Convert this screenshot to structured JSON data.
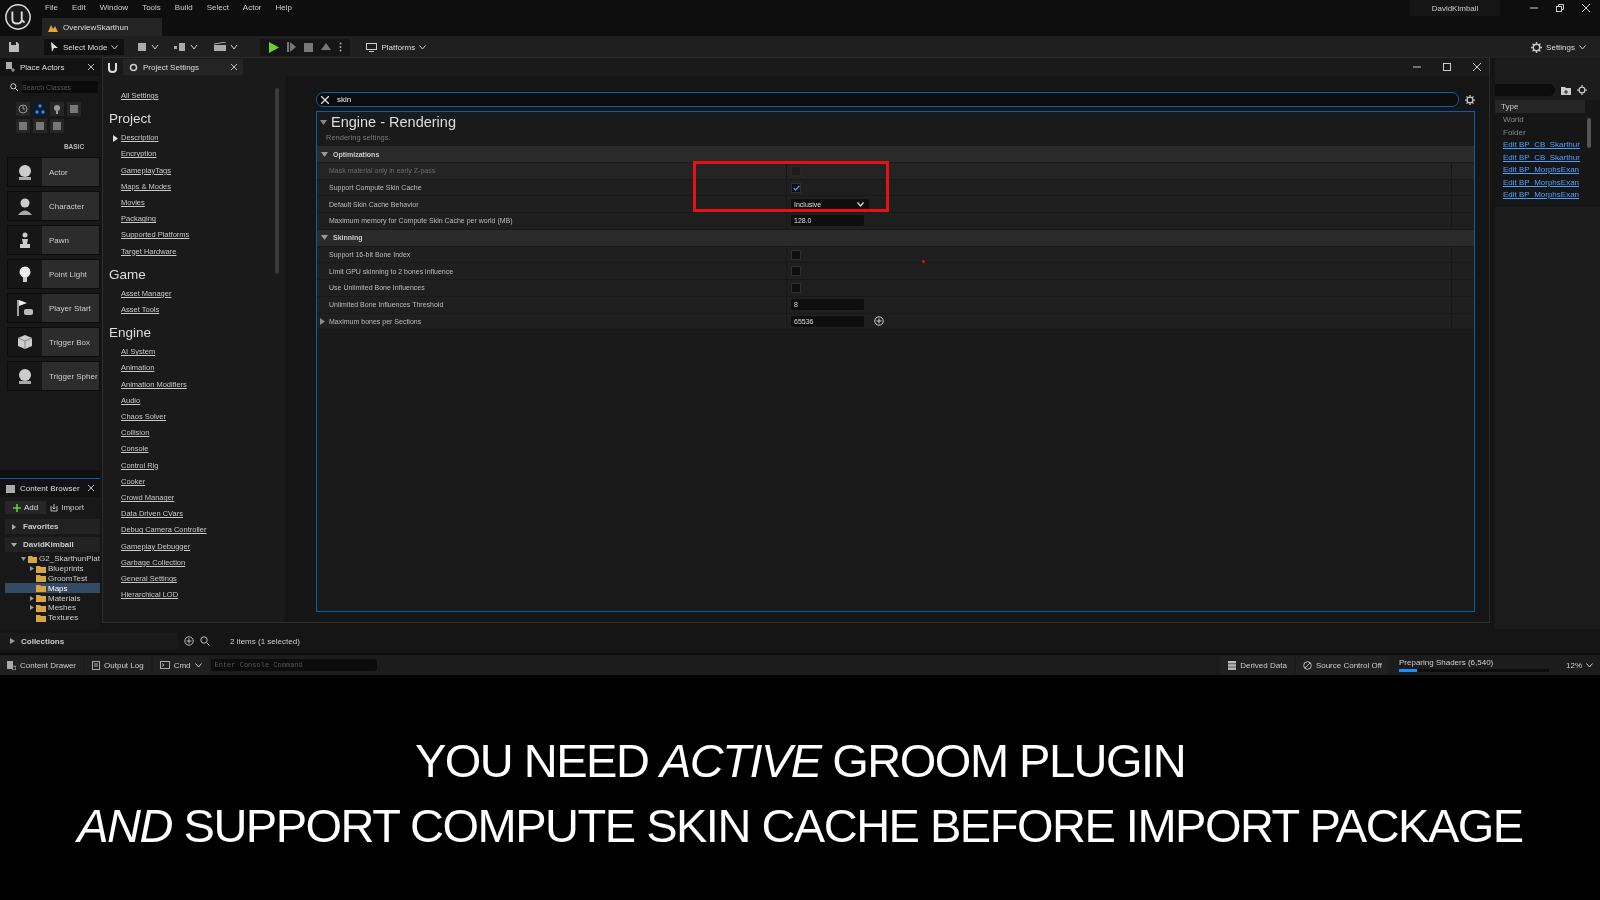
{
  "menu": [
    "File",
    "Edit",
    "Window",
    "Tools",
    "Build",
    "Select",
    "Actor",
    "Help"
  ],
  "level_tab": "OverviewSkarthun",
  "user": "DavidKimball",
  "toolbar": {
    "mode": "Select Mode",
    "platforms": "Platforms",
    "settings": "Settings"
  },
  "place_actors": {
    "title": "Place Actors",
    "search_placeholder": "Search Classes",
    "category_icons": [
      {
        "selected": false
      },
      {
        "selected": true
      },
      {
        "selected": false
      },
      {
        "selected": false
      },
      {
        "selected": false
      },
      {
        "selected": false
      },
      {
        "selected": false
      }
    ],
    "category": "BASIC",
    "items": [
      "Actor",
      "Character",
      "Pawn",
      "Point Light",
      "Player Start",
      "Trigger Box",
      "Trigger Spher"
    ]
  },
  "content_browser": {
    "title": "Content Browser",
    "add": "Add",
    "import": "Import",
    "sections": [
      {
        "label": "Favorites",
        "expanded": false
      },
      {
        "label": "DavidKimball",
        "expanded": true
      }
    ],
    "tree": [
      {
        "label": "G2_SkarthunPlat",
        "kind": "branch",
        "expanded": true,
        "selected": false,
        "children": [
          {
            "label": "Blueprints",
            "kind": "branch",
            "expanded": false,
            "selected": false
          },
          {
            "label": "GroomTest",
            "kind": "leaf",
            "selected": false
          },
          {
            "label": "Maps",
            "kind": "leaf",
            "selected": true
          },
          {
            "label": "Materials",
            "kind": "branch",
            "expanded": false,
            "selected": false
          },
          {
            "label": "Meshes",
            "kind": "branch",
            "expanded": false,
            "selected": false
          },
          {
            "label": "Textures",
            "kind": "leaf",
            "selected": false
          }
        ]
      }
    ],
    "collections": "Collections",
    "status": "2 items (1 selected)"
  },
  "outliner": {
    "column": "Type",
    "rows": [
      {
        "text": "World",
        "link": false
      },
      {
        "text": "Folder",
        "link": false
      },
      {
        "text": "Edit BP_CB_Skarthur",
        "link": true
      },
      {
        "text": "Edit BP_CB_Skarthur",
        "link": true
      },
      {
        "text": "Edit BP_MorphsExan",
        "link": true
      },
      {
        "text": "Edit BP_MorphsExan",
        "link": true
      },
      {
        "text": "Edit BP_MorphsExan",
        "link": true
      }
    ]
  },
  "project_settings": {
    "tab": "Project Settings",
    "all_settings": "All Settings",
    "nav_groups": [
      {
        "heading": "Project",
        "items": [
          {
            "label": "Description",
            "arrow": true
          },
          {
            "label": "Encryption",
            "arrow": false
          },
          {
            "label": "GameplayTags",
            "arrow": false
          },
          {
            "label": "Maps & Modes",
            "arrow": false
          },
          {
            "label": "Movies",
            "arrow": false
          },
          {
            "label": "Packaging",
            "arrow": false
          },
          {
            "label": "Supported Platforms",
            "arrow": false
          },
          {
            "label": "Target Hardware",
            "arrow": false
          }
        ]
      },
      {
        "heading": "Game",
        "items": [
          {
            "label": "Asset Manager",
            "arrow": false
          },
          {
            "label": "Asset Tools",
            "arrow": false
          }
        ]
      },
      {
        "heading": "Engine",
        "items": [
          {
            "label": "AI System",
            "arrow": false
          },
          {
            "label": "Animation",
            "arrow": false
          },
          {
            "label": "Animation Modifiers",
            "arrow": false
          },
          {
            "label": "Audio",
            "arrow": false
          },
          {
            "label": "Chaos Solver",
            "arrow": false
          },
          {
            "label": "Collision",
            "arrow": false
          },
          {
            "label": "Console",
            "arrow": false
          },
          {
            "label": "Control Rig",
            "arrow": false
          },
          {
            "label": "Cooker",
            "arrow": false
          },
          {
            "label": "Crowd Manager",
            "arrow": false
          },
          {
            "label": "Data Driven CVars",
            "arrow": false
          },
          {
            "label": "Debug Camera Controller",
            "arrow": false
          },
          {
            "label": "Gameplay Debugger",
            "arrow": false
          },
          {
            "label": "Garbage Collection",
            "arrow": false
          },
          {
            "label": "General Settings",
            "arrow": false
          },
          {
            "label": "Hierarchical LOD",
            "arrow": false
          }
        ]
      }
    ],
    "search": "skin",
    "section": {
      "title": "Engine - Rendering",
      "description": "Rendering settings.",
      "categories": [
        {
          "name": "Optimizations",
          "expanded": true,
          "rows": [
            {
              "label": "Mask material only in early Z-pass",
              "kind": "checkbox",
              "checked": false,
              "disabled": true
            },
            {
              "label": "Support Compute Skin Cache",
              "kind": "checkbox",
              "checked": true,
              "disabled": false
            },
            {
              "label": "Default Skin Cache Behavior",
              "kind": "dropdown",
              "value": "Inclusive",
              "disabled": false
            },
            {
              "label": "Maximum memory for Compute Skin Cache per world (MB)",
              "kind": "number",
              "value": "128.0",
              "disabled": false
            }
          ]
        },
        {
          "name": "Skinning",
          "expanded": true,
          "rows": [
            {
              "label": "Support 16-bit Bone Index",
              "kind": "checkbox",
              "checked": false,
              "disabled": false
            },
            {
              "label": "Limit GPU skinning to 2 bones influence",
              "kind": "checkbox",
              "checked": false,
              "disabled": false
            },
            {
              "label": "Use Unlimited Bone Influences",
              "kind": "checkbox",
              "checked": false,
              "disabled": false
            },
            {
              "label": "Unlimited Bone Influences Threshold",
              "kind": "number",
              "value": "8",
              "disabled": false
            },
            {
              "label": "Maximum bones per Sections",
              "kind": "array",
              "value": "65536",
              "disabled": false
            }
          ]
        }
      ]
    }
  },
  "bottom_bar": {
    "content_drawer": "Content Drawer",
    "output_log": "Output Log",
    "cmd": "Cmd",
    "console_placeholder": "Enter Console Command",
    "derived_data": "Derived Data",
    "source_control": "Source Control Off",
    "shaders": {
      "label": "Preparing Shaders (6,540)",
      "level": 0.12
    },
    "zoom": "12%"
  },
  "caption": [
    "YOU NEED *ACTIVE* GROOM PLUGIN",
    "*AND* SUPPORT COMPUTE SKIN CACHE BEFORE IMPORT PACKAGE"
  ]
}
